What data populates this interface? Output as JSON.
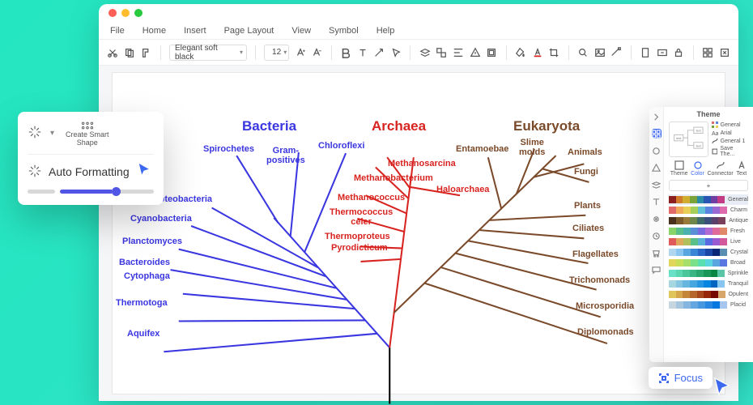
{
  "menus": {
    "file": "File",
    "home": "Home",
    "insert": "Insert",
    "page_layout": "Page Layout",
    "view": "View",
    "symbol": "Symbol",
    "help": "Help"
  },
  "toolbar": {
    "font": "Elegant soft black",
    "size": "12"
  },
  "popover": {
    "create_smart_line1": "Create Smart",
    "create_smart_line2": "Shape",
    "auto_formatting": "Auto Formatting"
  },
  "diagram": {
    "headings": {
      "bacteria": "Bacteria",
      "archaea": "Archaea",
      "eukaryota": "Eukaryota"
    },
    "bacteria": [
      "Spirochetes",
      "Gram-\npositives",
      "Chloroflexi",
      "Proteobacteria",
      "Cyanobacteria",
      "Planctomyces",
      "Bacteroides",
      "Cytophaga",
      "Thermotoga",
      "Aquifex"
    ],
    "archaea": [
      "Methanosarcina",
      "Methanobacterium",
      "Methanococcus",
      "Thermococcus\nceler",
      "Thermoproteus",
      "Pyrodicticum",
      "Haloarchaea"
    ],
    "eukaryota": [
      "Entamoebae",
      "Slime\nmolds",
      "Animals",
      "Fungi",
      "Plants",
      "Ciliates",
      "Flagellates",
      "Trichomonads",
      "Microsporidia",
      "Diplomonads"
    ]
  },
  "focus": {
    "label": "Focus"
  },
  "theme": {
    "title": "Theme",
    "meta": [
      "General",
      "Arial",
      "General 1",
      "Save The..."
    ],
    "tabs": [
      "Theme",
      "Color",
      "Connector",
      "Text"
    ],
    "add": "+",
    "palettes": [
      "General",
      "Charm",
      "Antique",
      "Fresh",
      "Live",
      "Crystal",
      "Broad",
      "Sprinkle",
      "Tranquil",
      "Opulent",
      "Placid"
    ]
  },
  "palette_colors": [
    [
      "#8b1e1e",
      "#d17a2a",
      "#cfae2f",
      "#7aa33a",
      "#2b8aa6",
      "#2956b2",
      "#6e3fa0",
      "#c33b84"
    ],
    [
      "#e06a6a",
      "#f0a85a",
      "#e7cf58",
      "#a6cf5a",
      "#62c0d6",
      "#5a84e0",
      "#9a6ad2",
      "#e06aae"
    ],
    [
      "#4a2f1d",
      "#7a5a2a",
      "#9a7a3a",
      "#6f864a",
      "#3f6a6a",
      "#3a4f7a",
      "#5a3f6a",
      "#7a3f5a"
    ],
    [
      "#88d36a",
      "#5ac08a",
      "#4ab0b0",
      "#5a8ed6",
      "#7a6ae0",
      "#b06ad2",
      "#e06a9a",
      "#e0886a"
    ],
    [
      "#e05a5a",
      "#e0a85a",
      "#b0c05a",
      "#5ac08a",
      "#5ab0d6",
      "#5a6ae0",
      "#9a5ad2",
      "#d25a9a"
    ],
    [
      "#b0d6f0",
      "#8ac6f0",
      "#5aa6e0",
      "#3a86d6",
      "#2a66c6",
      "#1a46a6",
      "#0a2676",
      "#5a8eb0"
    ],
    [
      "#e0d65a",
      "#c6e05a",
      "#a6e06a",
      "#7ae08a",
      "#5ae0b0",
      "#5ad6e0",
      "#5aa6e0",
      "#5a76e0"
    ],
    [
      "#6ae0c6",
      "#5ad6b0",
      "#4ac69a",
      "#3ab684",
      "#2aa66e",
      "#1a9658",
      "#0a8642",
      "#5ac6a6"
    ],
    [
      "#a6d6e0",
      "#86c6e0",
      "#66b6e0",
      "#46a6e0",
      "#2696e0",
      "#0686e0",
      "#0066c0",
      "#86c6f0"
    ],
    [
      "#e0c65a",
      "#d6a64a",
      "#c6863a",
      "#b6662a",
      "#a6461a",
      "#96260a",
      "#760600",
      "#d6a66a"
    ],
    [
      "#c6d6e0",
      "#a6c6e0",
      "#86b6e0",
      "#66a6e0",
      "#4696e0",
      "#2686e0",
      "#0676e0",
      "#a6c6f0"
    ]
  ]
}
